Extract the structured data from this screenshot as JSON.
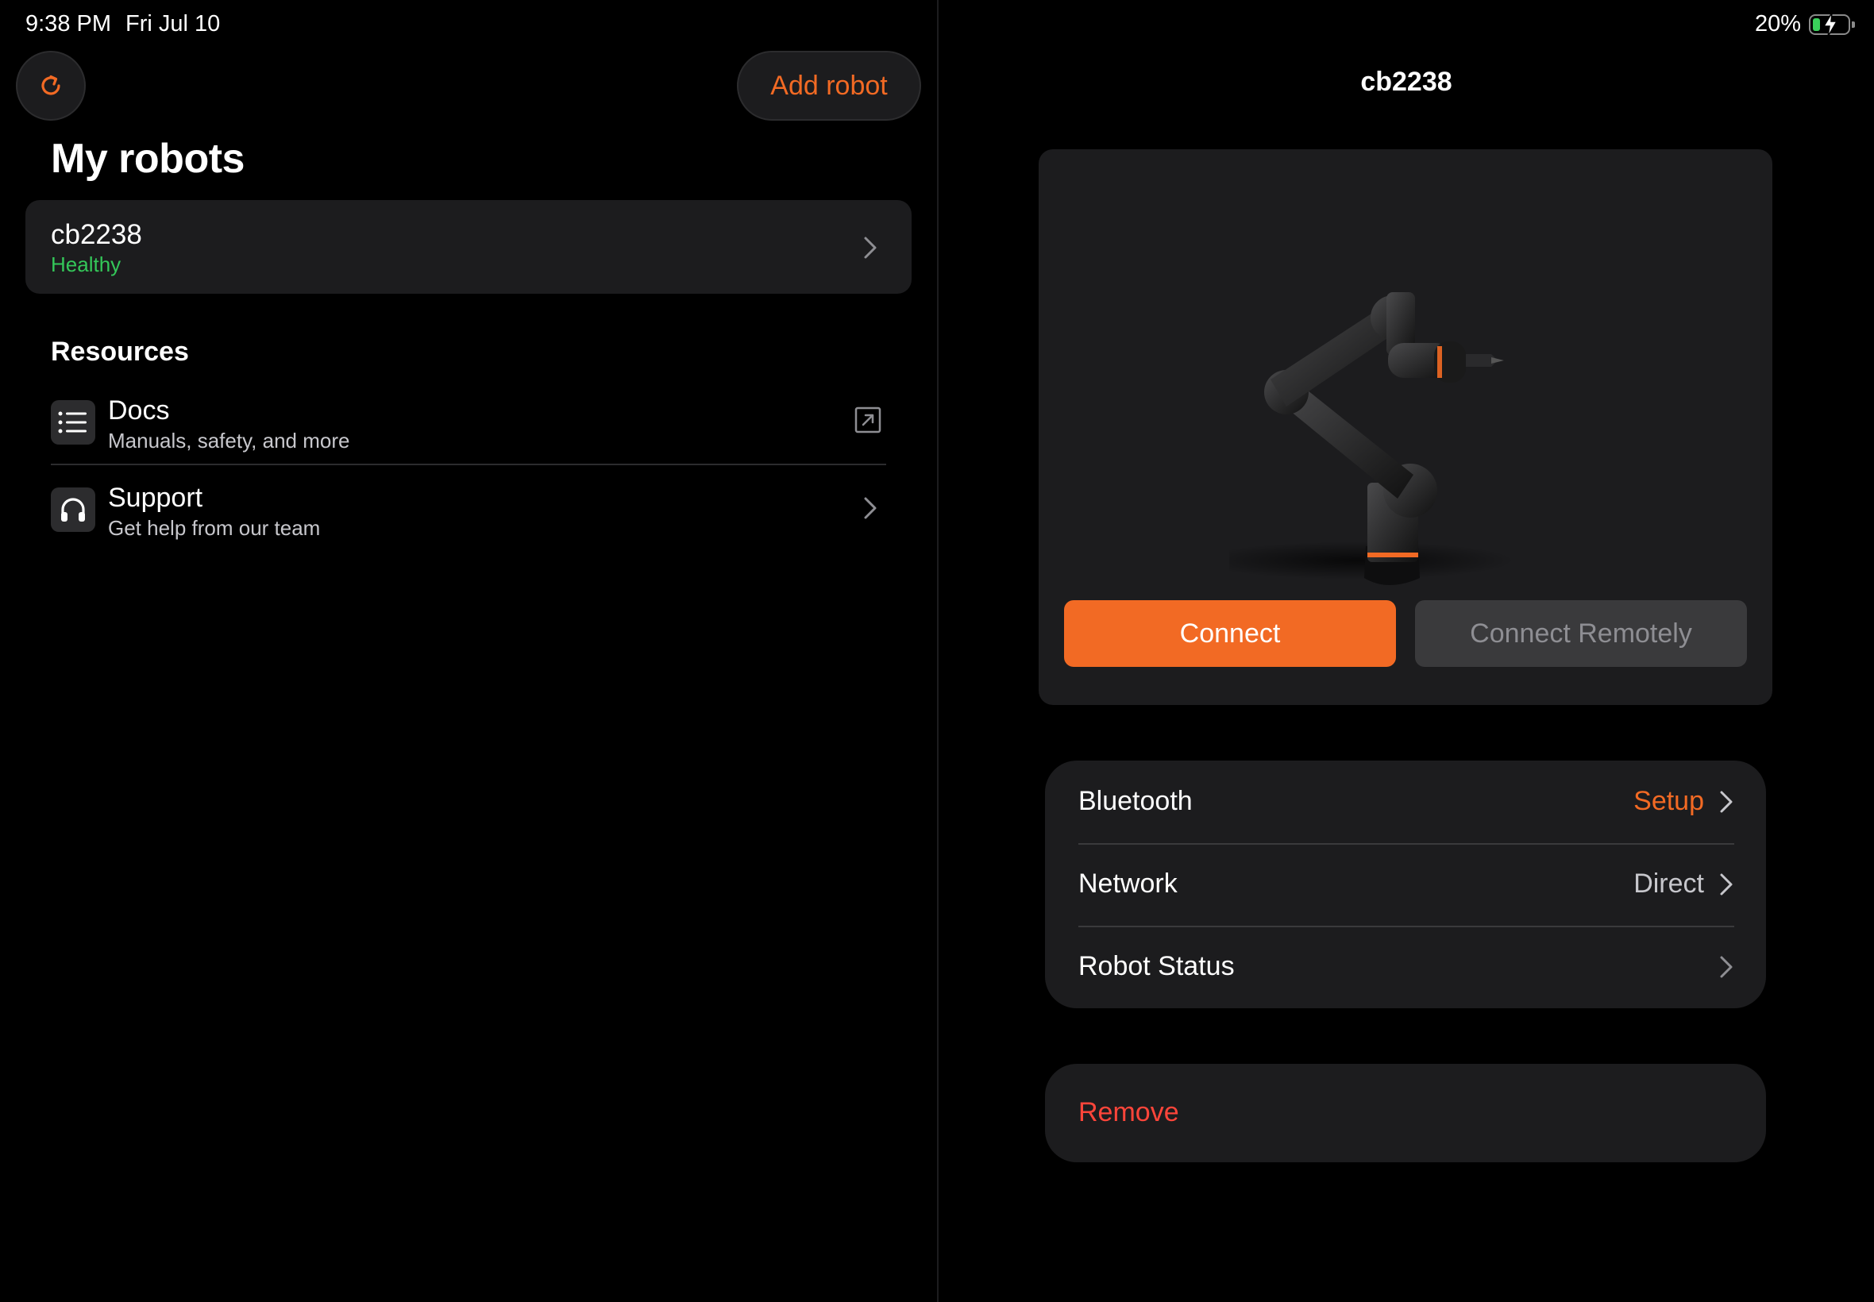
{
  "status_bar": {
    "time": "9:38 PM",
    "date": "Fri Jul 10",
    "battery_percent": "20%",
    "battery_level": 0.2,
    "battery_state": "charging"
  },
  "left": {
    "refresh_icon": "refresh-icon",
    "add_robot_label": "Add robot",
    "title": "My robots",
    "robots": [
      {
        "name": "cb2238",
        "status": "Healthy"
      }
    ],
    "resources_title": "Resources",
    "resources": [
      {
        "title": "Docs",
        "subtitle": "Manuals, safety, and more",
        "icon": "list-icon",
        "trailing_icon": "external-link-icon"
      },
      {
        "title": "Support",
        "subtitle": "Get help from our team",
        "icon": "headphones-icon",
        "trailing_icon": "chevron-right-icon"
      }
    ]
  },
  "right": {
    "title": "cb2238",
    "connect_label": "Connect",
    "connect_remotely_label": "Connect Remotely",
    "settings": [
      {
        "label": "Bluetooth",
        "value": "Setup"
      },
      {
        "label": "Network",
        "value": "Direct"
      },
      {
        "label": "Robot Status",
        "value": ""
      }
    ],
    "remove_label": "Remove"
  },
  "colors": {
    "background": "#000000",
    "surface": "#1c1c1e",
    "accent": "#f26a24",
    "healthy": "#34c759",
    "destructive": "#ff453a",
    "secondary_text": "#c7c7cc",
    "disabled_text": "#8e8e93"
  }
}
